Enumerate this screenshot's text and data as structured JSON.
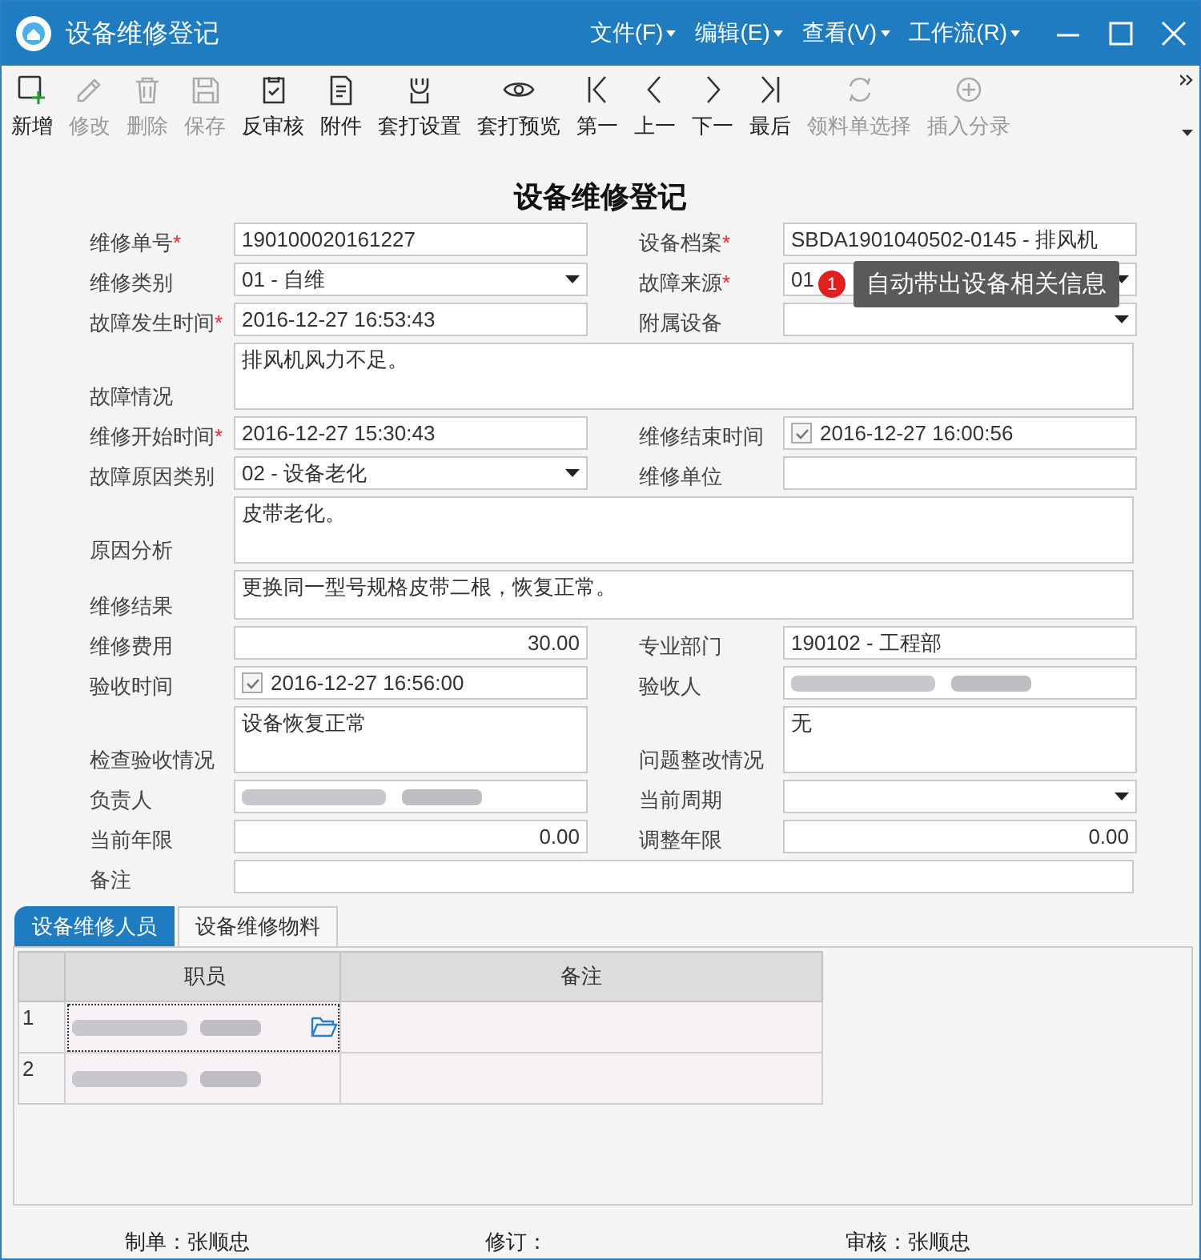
{
  "window": {
    "title": "设备维修登记",
    "menus": [
      "文件(F)",
      "编辑(E)",
      "查看(V)",
      "工作流(R)"
    ]
  },
  "toolbar": [
    {
      "label": "新增",
      "disabled": false
    },
    {
      "label": "修改",
      "disabled": true
    },
    {
      "label": "删除",
      "disabled": true
    },
    {
      "label": "保存",
      "disabled": true
    },
    {
      "label": "反审核",
      "disabled": false
    },
    {
      "label": "附件",
      "disabled": false
    },
    {
      "label": "套打设置",
      "disabled": false
    },
    {
      "label": "套打预览",
      "disabled": false
    },
    {
      "label": "第一",
      "disabled": false
    },
    {
      "label": "上一",
      "disabled": false
    },
    {
      "label": "下一",
      "disabled": false
    },
    {
      "label": "最后",
      "disabled": false
    },
    {
      "label": "领料单选择",
      "disabled": true
    },
    {
      "label": "插入分录",
      "disabled": true
    }
  ],
  "form": {
    "title": "设备维修登记",
    "rows": [
      [
        {
          "label": "维修单号",
          "mark": "*",
          "kind": "text",
          "value": "190100020161227"
        },
        {
          "label": "设备档案",
          "mark": "*",
          "kind": "text",
          "value": "SBDA1901040502-0145 - 排风机"
        }
      ],
      [
        {
          "label": "维修类别",
          "kind": "select",
          "value": "01 - 自维"
        },
        {
          "label": "故障来源",
          "mark": "*",
          "kind": "select",
          "value": "01"
        }
      ],
      [
        {
          "label": "故障发生时间",
          "mark": "*",
          "kind": "text",
          "value": "2016-12-27 16:53:43"
        },
        {
          "label": "附属设备",
          "kind": "select"
        }
      ],
      [
        {
          "label": "故障情况",
          "kind": "memo",
          "value": "排风机风力不足。"
        }
      ],
      [
        {
          "label": "维修开始时间",
          "mark": "*",
          "kind": "text",
          "value": "2016-12-27 15:30:43"
        },
        {
          "label": "维修结束时间",
          "kind": "checkdate",
          "checked": true,
          "value": "2016-12-27 16:00:56"
        }
      ],
      [
        {
          "label": "故障原因类别",
          "kind": "select",
          "value": "02 - 设备老化"
        },
        {
          "label": "维修单位",
          "kind": "text"
        }
      ],
      [
        {
          "label": "原因分析",
          "kind": "memo",
          "value": "皮带老化。"
        }
      ],
      [
        {
          "label": "维修结果",
          "kind": "note",
          "value": "更换同一型号规格皮带二根，恢复正常。"
        }
      ],
      [
        {
          "label": "维修费用",
          "kind": "number",
          "value": "30.00"
        },
        {
          "label": "专业部门",
          "kind": "text",
          "value": "190102 - 工程部"
        }
      ],
      [
        {
          "label": "验收时间",
          "kind": "checkdate",
          "checked": true,
          "value": "2016-12-27 16:56:00"
        },
        {
          "label": "验收人",
          "kind": "redacted"
        }
      ],
      [
        {
          "label": "检查验收情况",
          "kind": "memo",
          "value": "设备恢复正常"
        },
        {
          "label": "问题整改情况",
          "kind": "memo",
          "value": "无"
        }
      ],
      [
        {
          "label": "负责人",
          "kind": "redacted"
        },
        {
          "label": "当前周期",
          "kind": "select"
        }
      ],
      [
        {
          "label": "当前年限",
          "kind": "number",
          "value": "0.00"
        },
        {
          "label": "调整年限",
          "kind": "number",
          "value": "0.00"
        }
      ],
      [
        {
          "label": "备注",
          "kind": "text"
        }
      ]
    ]
  },
  "tooltip": {
    "badge": "1",
    "text": "自动带出设备相关信息"
  },
  "tabs": [
    {
      "label": "设备维修人员",
      "selected": true
    },
    {
      "label": "设备维修物料",
      "selected": false
    }
  ],
  "table": {
    "columns": [
      "职员",
      "备注"
    ],
    "rows": [
      {
        "number": "1",
        "focused": true
      },
      {
        "number": "2",
        "focused": false
      }
    ]
  },
  "footer": [
    {
      "label": "制单：张顺忠"
    },
    {
      "label": "修订："
    },
    {
      "label": "审核：张顺忠"
    }
  ]
}
